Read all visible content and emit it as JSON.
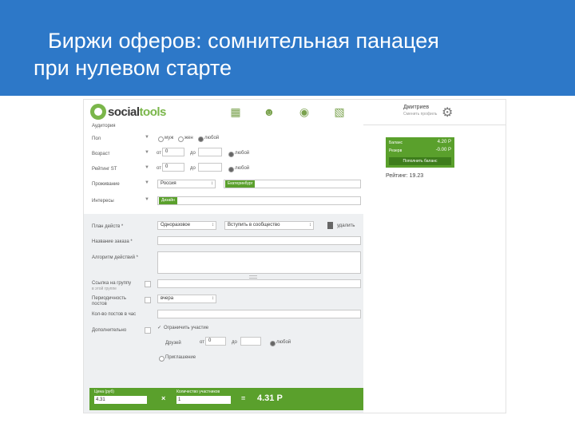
{
  "slide": {
    "title_line1": "Биржи оферов: сомнительная панацея",
    "title_line2": "при нулевом старте"
  },
  "app": {
    "logo_part1": "social",
    "logo_part2": "tools",
    "user_name": "Дмитриев",
    "user_sub": "Сменить профиль"
  },
  "form": {
    "section_audience": "Аудитория",
    "gender": {
      "label": "Пол",
      "options": [
        "муж",
        "жен",
        "любой"
      ],
      "selected": "любой"
    },
    "age": {
      "label": "Возраст",
      "from": "от",
      "from_value": "0",
      "to": "до",
      "any": "любой"
    },
    "rating": {
      "label": "Рейтинг ST",
      "from": "от",
      "from_value": "0",
      "to": "до",
      "any": "любой"
    },
    "location": {
      "label": "Проживание",
      "country": "Россия",
      "city_tag": "Екатеринбург"
    },
    "interests": {
      "label": "Интересы",
      "tag": "Дизайн"
    },
    "task_type": {
      "label": "План действ *",
      "value1": "Одноразовое",
      "value2": "Вступить в сообщество",
      "delete_label": "удалить"
    },
    "order_name": {
      "label": "Название заказа *"
    },
    "algorithm": {
      "label": "Алгоритм действий *"
    },
    "group_link": {
      "label": "Ссылка на группу",
      "sub": "в этой группе"
    },
    "periodicity": {
      "label": "Периодичность постов",
      "value": "вчера"
    },
    "posts_per_hour": {
      "label": "Кол-во постов в час"
    },
    "extra": {
      "label": "Дополнительно",
      "limit_label": "Ограничить участие",
      "friends_label": "Друзей",
      "from": "от",
      "from_value": "0",
      "to": "до",
      "any": "любой",
      "invite_label": "Приглашение"
    },
    "price": {
      "label": "Цена (руб)",
      "value": "4.31",
      "op": "×"
    },
    "quantity": {
      "label": "Количество участников",
      "value": "1",
      "op": "="
    },
    "total": "4.31 Р"
  },
  "balance": {
    "rows": [
      {
        "label": "Баланс",
        "value": "4.20 Р"
      },
      {
        "label": "Резерв",
        "value": "-0.00 Р"
      }
    ],
    "button": "Пополнить баланс",
    "rating_label": "Рейтинг:",
    "rating_value": "19.23"
  },
  "icons": [
    "logo-icon",
    "clipboard-icon",
    "face-icon",
    "chat-bubble-icon",
    "chats-icon",
    "gear-icon",
    "trash-icon"
  ],
  "colors": {
    "header_blue": "#2d78c8",
    "accent_green": "#5aa02c",
    "logo_green": "#7ab64a"
  }
}
